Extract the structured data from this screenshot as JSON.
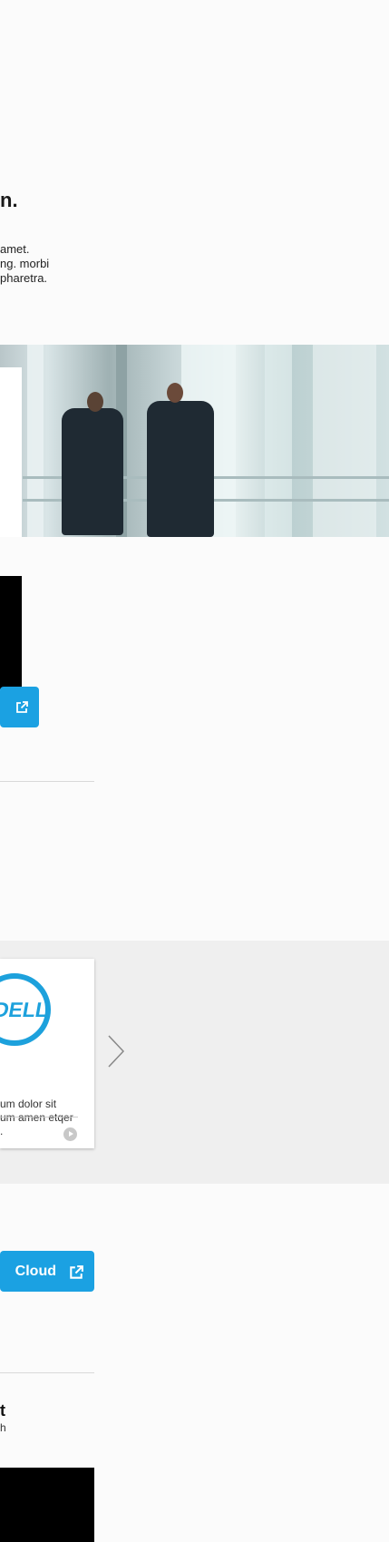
{
  "intro": {
    "heading": "n.",
    "paragraph": [
      "amet.",
      "ng. morbi",
      "pharetra."
    ]
  },
  "photo": {
    "alt": "Two businessmen walking in glass office"
  },
  "cta1": {
    "icon": "external-link-icon"
  },
  "carousel": {
    "card": {
      "logo": "DELL",
      "text": [
        "um dolor sit",
        "um amen etqer",
        "."
      ],
      "play_icon": "play-icon"
    },
    "next_icon": "chevron-right-icon"
  },
  "cta2": {
    "label": "Cloud",
    "icon": "external-link-icon"
  },
  "sub": {
    "title": "t",
    "text": "h"
  },
  "colors": {
    "accent": "#1ba1e2",
    "band": "#efefef",
    "dell_blue": "#1da1dc"
  }
}
